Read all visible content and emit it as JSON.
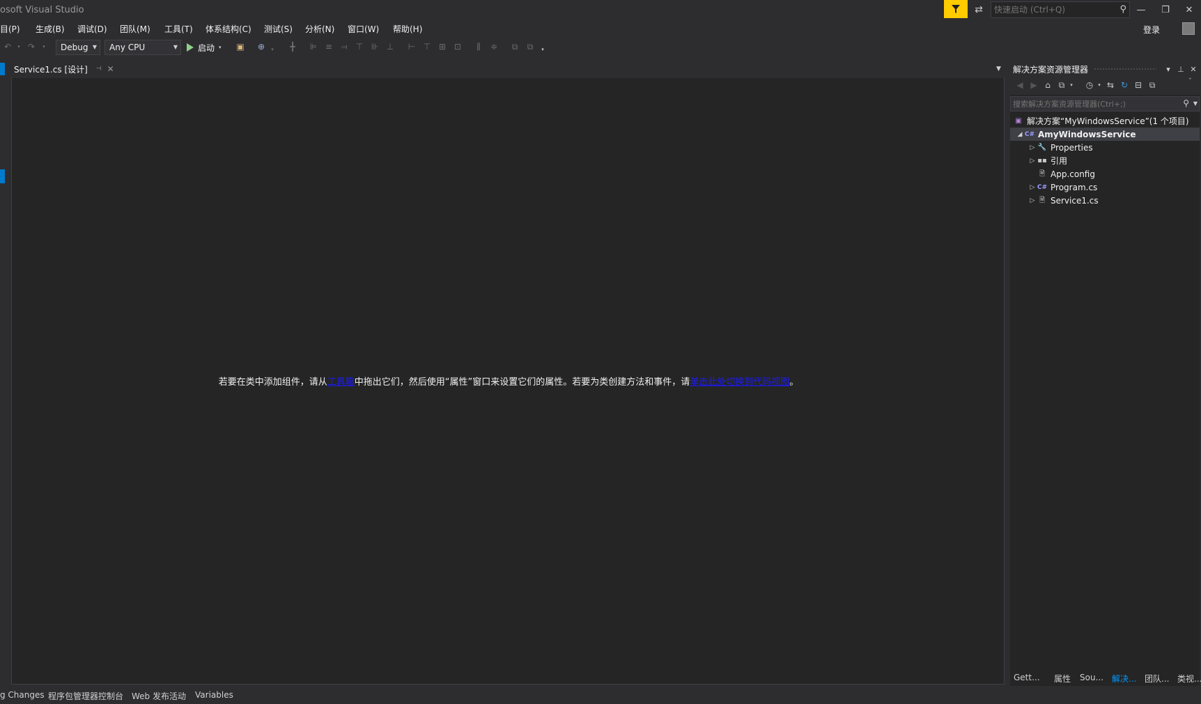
{
  "window": {
    "title": "osoft Visual Studio",
    "quick_launch_placeholder": "快速启动 (Ctrl+Q)",
    "sign_in": "登录"
  },
  "menu": [
    "目(P)",
    "生成(B)",
    "调试(D)",
    "团队(M)",
    "工具(T)",
    "体系结构(C)",
    "测试(S)",
    "分析(N)",
    "窗口(W)",
    "帮助(H)"
  ],
  "toolbar": {
    "config": "Debug",
    "platform": "Any CPU",
    "start_label": "启动"
  },
  "document_tab": {
    "label": "Service1.cs [设计]"
  },
  "designer": {
    "msg_part1": "若要在类中添加组件，请从",
    "link1": "工具箱",
    "msg_part2": "中拖出它们，然后使用“属性”窗口来设置它们的属性。若要为类创建方法和事件，请",
    "link2": "单击此处切换到代码视图",
    "msg_part3": "。"
  },
  "solution_explorer": {
    "title": "解决方案资源管理器",
    "search_placeholder": "搜索解决方案资源管理器(Ctrl+;)",
    "tree": [
      {
        "label": "解决方案“MyWindowsService”(1 个项目)",
        "icon": "solution-icon"
      },
      {
        "label": "AmyWindowsService",
        "icon": "csharp-project-icon"
      },
      {
        "label": "Properties",
        "icon": "wrench-icon"
      },
      {
        "label": "引用",
        "icon": "references-icon"
      },
      {
        "label": "App.config",
        "icon": "config-file-icon"
      },
      {
        "label": "Program.cs",
        "icon": "csharp-file-icon"
      },
      {
        "label": "Service1.cs",
        "icon": "service-file-icon"
      }
    ],
    "bottom_tabs": [
      "Gett...",
      "属性",
      "Sou...",
      "解决...",
      "团队...",
      "类视..."
    ]
  },
  "bottom_tabs": [
    "g Changes",
    "程序包管理器控制台",
    "Web 发布活动",
    "Variables"
  ],
  "colors": {
    "accent": "#007acc",
    "filter": "#ffcc00",
    "link": "#1a1aff",
    "active_tab": "#0097fb"
  }
}
